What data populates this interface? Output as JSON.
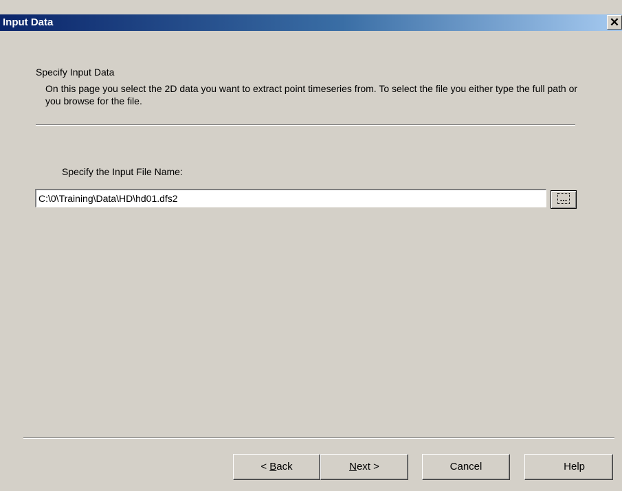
{
  "window": {
    "title": "Input Data",
    "close_glyph": "✕"
  },
  "header": {
    "title": "Specify Input Data",
    "description": "On this page you select the 2D data you want to extract point timeseries from. To select the file you either type the full path or you browse for the file."
  },
  "form": {
    "file_label": "Specify the Input File Name:",
    "file_path": "C:\\0\\Training\\Data\\HD\\hd01.dfs2",
    "browse_label": "..."
  },
  "buttons": {
    "back": {
      "prefix": "< ",
      "accel": "B",
      "rest": "ack"
    },
    "next": {
      "accel": "N",
      "rest": "ext >"
    },
    "cancel": "Cancel",
    "help": "Help"
  }
}
